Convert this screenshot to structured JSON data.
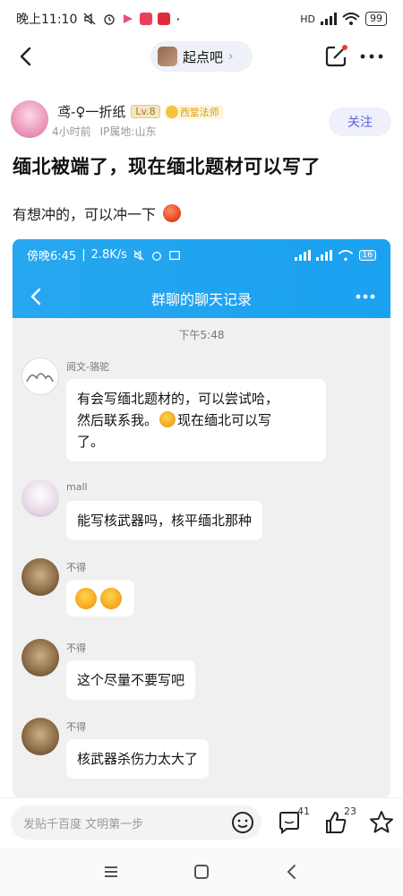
{
  "status_bar": {
    "time": "晚上11:10",
    "network": "HD",
    "battery": "99"
  },
  "nav": {
    "forum_name": "起点吧",
    "chevron": "›"
  },
  "author": {
    "name": "鸢-♀一折纸",
    "level": "Lv.8",
    "title_badge": "西堂法师",
    "time_ago": "4小时前",
    "ip_location": "IP属地:山东",
    "follow_label": "关注"
  },
  "post": {
    "title": "缅北被端了，现在缅北题材可以写了",
    "body": "有想冲的，可以冲一下"
  },
  "screenshot": {
    "status_time": "傍晚6:45",
    "status_speed": "2.8K/s",
    "status_battery": "16",
    "chat_title": "群聊的聊天记录",
    "timestamp": "下午5:48",
    "messages": [
      {
        "nick": "阅文-骆驼",
        "text_a": "有会写缅北题材的，可以尝试哈，",
        "text_b": "然后联系我。",
        "text_c": "现在缅北可以写",
        "text_d": "了。"
      },
      {
        "nick": "mall",
        "text": "能写核武器吗，核平缅北那种"
      },
      {
        "nick": "不得",
        "text": ""
      },
      {
        "nick": "不得",
        "text": "这个尽量不要写吧"
      },
      {
        "nick": "不得",
        "text": "核武器杀伤力太大了"
      }
    ]
  },
  "action_bar": {
    "reply_placeholder": "发贴千百度 文明第一步",
    "comment_count": "41",
    "like_count": "23"
  },
  "colors": {
    "accent": "#5a63d8",
    "chat_header": "#1ea4f0"
  }
}
